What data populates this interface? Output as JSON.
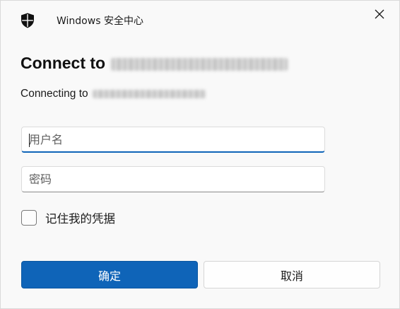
{
  "window": {
    "app_title": "Windows 安全中心",
    "icon": "shield-icon",
    "close_icon": "close-icon"
  },
  "dialog": {
    "heading_prefix": "Connect to",
    "subheading_prefix": "Connecting to"
  },
  "form": {
    "username_placeholder": "用户名",
    "password_placeholder": "密码",
    "remember_label": "记住我的凭据",
    "remember_checked": false
  },
  "buttons": {
    "ok_label": "确定",
    "cancel_label": "取消"
  },
  "colors": {
    "accent": "#0f64b8",
    "background": "#f9f9f9"
  }
}
